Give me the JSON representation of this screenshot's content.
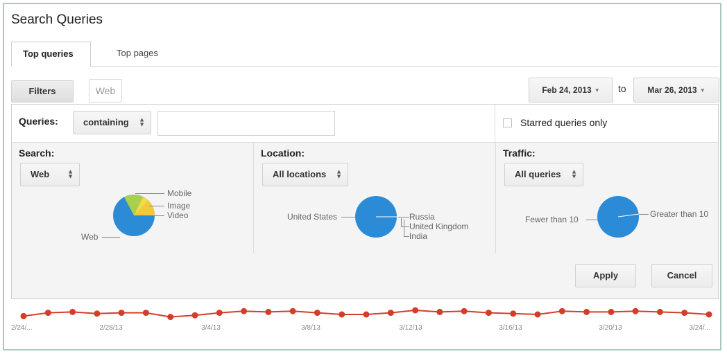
{
  "page_title": "Search Queries",
  "tabs": [
    {
      "label": "Top queries",
      "active": true
    },
    {
      "label": "Top pages",
      "active": false
    }
  ],
  "filters_button": "Filters",
  "filter_chip": "Web",
  "date_range": {
    "start": "Feb 24, 2013",
    "to_label": "to",
    "end": "Mar 26, 2013"
  },
  "queries": {
    "label": "Queries:",
    "match_type": "containing",
    "value": "",
    "placeholder": "",
    "starred_label": "Starred queries only",
    "starred_checked": false
  },
  "search": {
    "label": "Search:",
    "selected": "Web",
    "pie_labels": [
      "Mobile",
      "Image",
      "Video",
      "Web"
    ],
    "pie_colors": [
      "#a8d04a",
      "#f5c83a",
      "#e8e050",
      "#2b8bd6"
    ]
  },
  "location": {
    "label": "Location:",
    "selected": "All locations",
    "pie_labels": [
      "United States",
      "Russia",
      "United Kingdom",
      "India"
    ],
    "pie_color": "#2b8bd6"
  },
  "traffic": {
    "label": "Traffic:",
    "selected": "All queries",
    "pie_labels": [
      "Fewer than 10",
      "Greater than 10"
    ],
    "pie_color": "#2b8bd6"
  },
  "actions": {
    "apply": "Apply",
    "cancel": "Cancel"
  },
  "chart_data": {
    "type": "line",
    "x_tick_labels": [
      "2/24/...",
      "2/28/13",
      "3/4/13",
      "3/8/13",
      "3/12/13",
      "3/16/13",
      "3/20/13",
      "3/24/..."
    ],
    "series_color": "#d43d2a",
    "values": [
      58,
      62,
      63,
      61,
      62,
      62,
      57,
      59,
      62,
      64,
      63,
      64,
      62,
      60,
      60,
      62,
      65,
      63,
      64,
      62,
      61,
      60,
      64,
      63,
      63,
      64,
      63,
      62,
      60
    ],
    "grid": false
  }
}
